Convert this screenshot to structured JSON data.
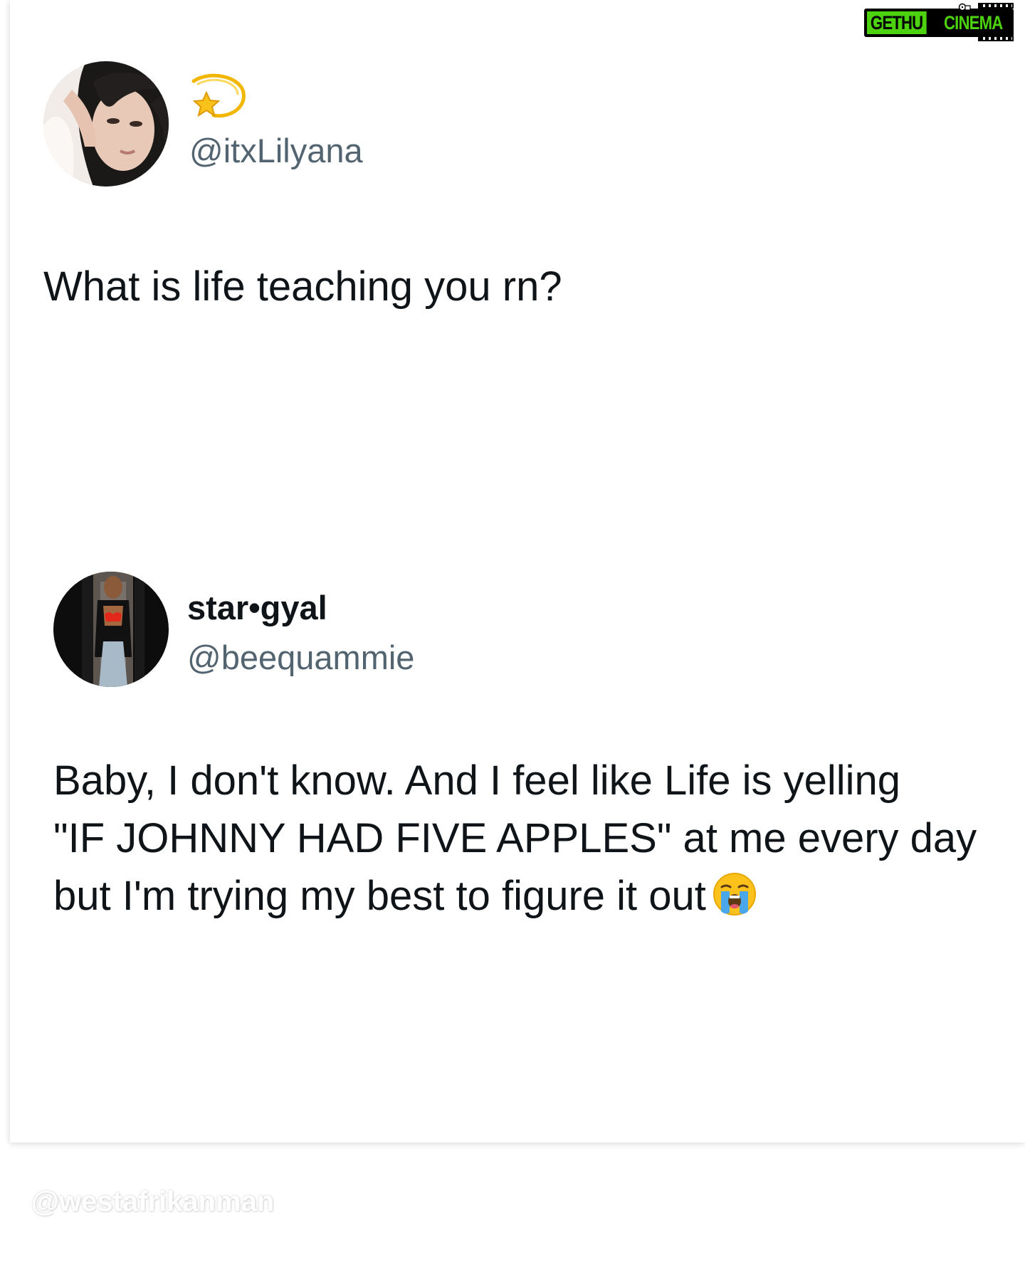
{
  "watermark_logo": {
    "part1": "GETHU",
    "part2": "CINEMA",
    "colors": {
      "primary": "#4cd20e",
      "dark": "#000000"
    }
  },
  "original_tweet": {
    "avatar_icon": "profile-photo",
    "badge_emoji": "dizzy-star-emoji",
    "handle": "@itxLilyana",
    "text": "What is life teaching you rn?"
  },
  "reply_tweet": {
    "avatar_icon": "profile-photo",
    "display_name": "star•gyal",
    "handle": "@beequammie",
    "text_lines": [
      "Baby, I don't know. And I feel like Life is yelling",
      "\"IF JOHNNY HAD FIVE APPLES\" at me every day",
      "but I'm trying my best to figure it out"
    ],
    "trailing_emoji": "loudly-crying-face-emoji"
  },
  "credit": "@westafrikanman",
  "colors": {
    "text": "#0f1419",
    "secondary_text": "#536471",
    "background": "#ffffff"
  }
}
